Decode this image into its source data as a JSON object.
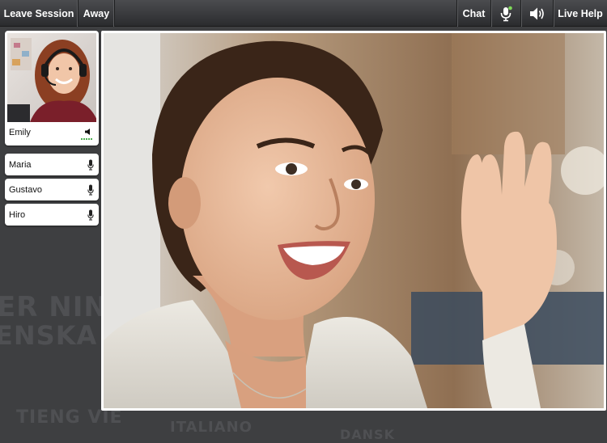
{
  "toolbar": {
    "leave_session": "Leave Session",
    "away": "Away",
    "chat": "Chat",
    "live_help": "Live Help",
    "mic_icon": "microphone-icon",
    "volume_icon": "speaker-volume-icon"
  },
  "self_participant": {
    "name": "Emily",
    "audio_icon": "speaker-icon",
    "level_color": "#4caf50"
  },
  "participants": [
    {
      "name": "Maria",
      "icon": "microphone-icon"
    },
    {
      "name": "Gustavo",
      "icon": "microphone-icon"
    },
    {
      "name": "Hiro",
      "icon": "microphone-icon"
    }
  ],
  "background_words": [
    "ER NIN",
    "ENSKA",
    "TIENG VIE",
    "ITALIANO",
    "DANSK"
  ],
  "colors": {
    "toolbar_top": "#4b4c4f",
    "toolbar_bottom": "#2b2c2e",
    "background": "#3e3f41",
    "mic_active": "#7ed957"
  }
}
